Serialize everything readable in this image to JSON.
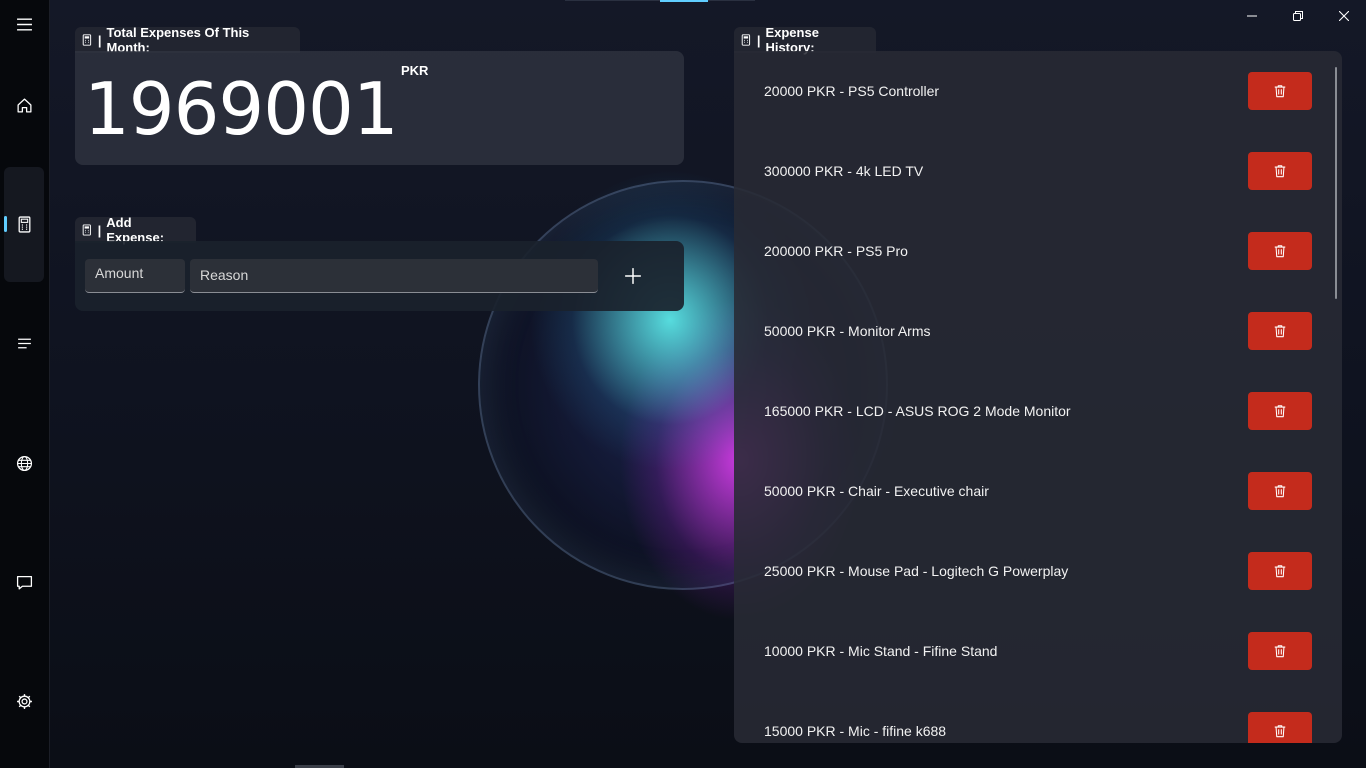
{
  "nav": {
    "items": [
      {
        "name": "hamburger-menu-icon"
      },
      {
        "name": "home-icon"
      },
      {
        "name": "calculator-icon",
        "selected": true
      },
      {
        "name": "list-icon"
      },
      {
        "name": "globe-icon"
      },
      {
        "name": "chat-icon"
      },
      {
        "name": "settings-gear-icon"
      }
    ],
    "accent_color": "#60cdff"
  },
  "total": {
    "header": "Total Expenses Of This Month:",
    "value": "1969001",
    "unit": "PKR"
  },
  "add_expense": {
    "header": "Add Expense:",
    "amount_placeholder": "Amount",
    "reason_placeholder": "Reason"
  },
  "history": {
    "header": "Expense History:",
    "delete_color": "#c42b1c",
    "items": [
      {
        "text": "20000 PKR - PS5 Controller"
      },
      {
        "text": "300000 PKR - 4k LED TV"
      },
      {
        "text": "200000 PKR - PS5 Pro"
      },
      {
        "text": "50000 PKR - Monitor Arms"
      },
      {
        "text": "165000 PKR - LCD - ASUS ROG 2 Mode Monitor"
      },
      {
        "text": "50000 PKR - Chair - Executive chair"
      },
      {
        "text": "25000 PKR - Mouse Pad - Logitech G Powerplay"
      },
      {
        "text": "10000 PKR - Mic Stand - Fifine Stand"
      },
      {
        "text": "15000 PKR - Mic - fifine k688"
      }
    ]
  }
}
